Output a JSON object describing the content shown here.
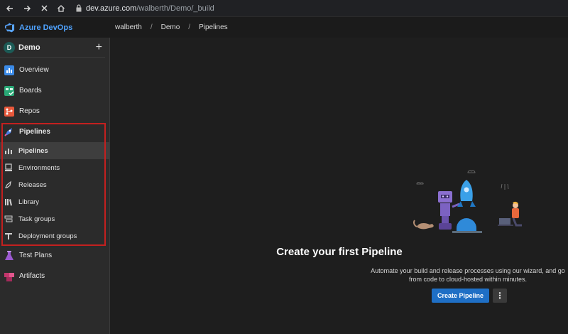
{
  "browser": {
    "url_domain": "dev.azure.com",
    "url_path": "/walberth/Demo/_build"
  },
  "header": {
    "brand": "Azure DevOps",
    "breadcrumb": [
      "walberth",
      "Demo",
      "Pipelines"
    ],
    "breadcrumb_separator": "/"
  },
  "sidebar": {
    "project": {
      "initial": "D",
      "name": "Demo",
      "add_symbol": "+"
    },
    "items": [
      {
        "label": "Overview",
        "icon": "overview-icon",
        "color": "#3b8be8"
      },
      {
        "label": "Boards",
        "icon": "boards-icon",
        "color": "#2aa876"
      },
      {
        "label": "Repos",
        "icon": "repos-icon",
        "color": "#e8583b"
      },
      {
        "label": "Pipelines",
        "icon": "pipelines-icon",
        "color": "#4a7ee8"
      }
    ],
    "pipelines_sub": [
      {
        "label": "Pipelines",
        "icon": "pipelines-sub-icon"
      },
      {
        "label": "Environments",
        "icon": "environments-icon"
      },
      {
        "label": "Releases",
        "icon": "releases-icon"
      },
      {
        "label": "Library",
        "icon": "library-icon"
      },
      {
        "label": "Task groups",
        "icon": "task-groups-icon"
      },
      {
        "label": "Deployment groups",
        "icon": "deployment-groups-icon"
      }
    ],
    "bottom_items": [
      {
        "label": "Test Plans",
        "icon": "test-plans-icon",
        "color": "#9b59d0"
      },
      {
        "label": "Artifacts",
        "icon": "artifacts-icon",
        "color": "#c2366b"
      }
    ],
    "highlight_color": "#c3201f"
  },
  "main": {
    "title": "Create your first Pipeline",
    "description": "Automate your build and release processes using our wizard, and go from code to cloud-hosted within minutes.",
    "create_button": "Create Pipeline",
    "more_symbol": "⋮",
    "accent": "#1f6fc5"
  }
}
